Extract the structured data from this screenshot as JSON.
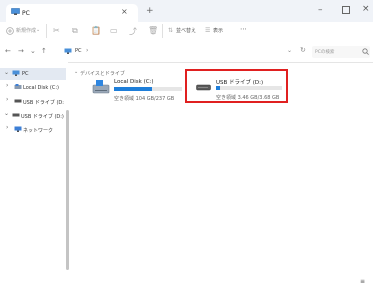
{
  "tab": {
    "title": "PC",
    "close": "×",
    "add": "+"
  },
  "window": {
    "minimize": "–",
    "close": "×"
  },
  "toolbar": {
    "new_label": "新規作成",
    "new_chevron": "⌄",
    "sort_label": "並べ替え",
    "view_label": "表示",
    "more": "⋯"
  },
  "address": {
    "segments": [
      "PC",
      "›"
    ],
    "search_placeholder": "PCの検索"
  },
  "sidebar": {
    "items": [
      {
        "label": "PC",
        "expander": "⌄"
      },
      {
        "label": "Local Disk (C:)",
        "expander": "›"
      },
      {
        "label": "USB ドライブ (D:",
        "expander": "›"
      },
      {
        "label": "USB ドライブ (D:)",
        "expander": "⌄"
      },
      {
        "label": "ネットワーク",
        "expander": "›"
      }
    ]
  },
  "content": {
    "group_label": "デバイスとドライブ",
    "group_chevron": "⌄",
    "drives": [
      {
        "name": "Local Disk (C:)",
        "free": "空き領域 104 GB/237 GB",
        "used_fraction": 0.56
      },
      {
        "name": "USB ドライブ (D:)",
        "free": "空き領域 3.46 GB/3.68 GB",
        "used_fraction": 0.06
      }
    ]
  },
  "colors": {
    "accent": "#1e7ed9",
    "highlight": "#e02020"
  }
}
